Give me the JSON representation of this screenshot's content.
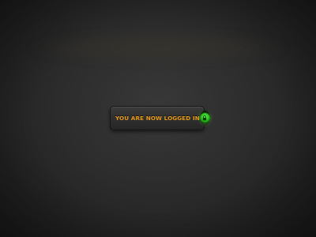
{
  "status": {
    "message": "YOU ARE NOW LOGGED IN",
    "icon": "lock-icon",
    "indicator_state": "on"
  },
  "colors": {
    "text": "#e69a16",
    "indicator": "#2fcc1e",
    "background": "#2c2c2c"
  }
}
